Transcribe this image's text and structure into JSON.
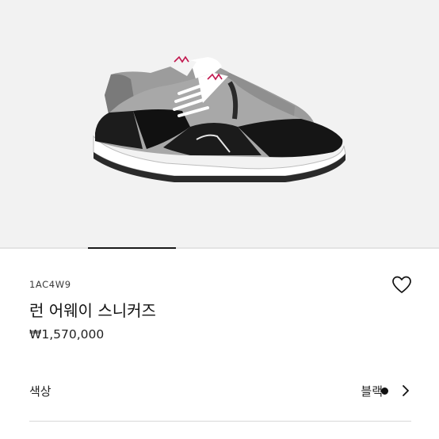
{
  "gallery": {
    "image_alt": "런 어웨이 스니커즈",
    "progress": 0.2
  },
  "product": {
    "sku": "1AC4W9",
    "name": "런 어웨이 스니커즈",
    "price": "₩1,570,000"
  },
  "actions": {
    "wishlist_icon": "heart-outline-icon"
  },
  "color_option": {
    "label": "색상",
    "value": "블랙",
    "swatch_color": "#111111",
    "chevron_icon": "chevron-right-icon"
  }
}
